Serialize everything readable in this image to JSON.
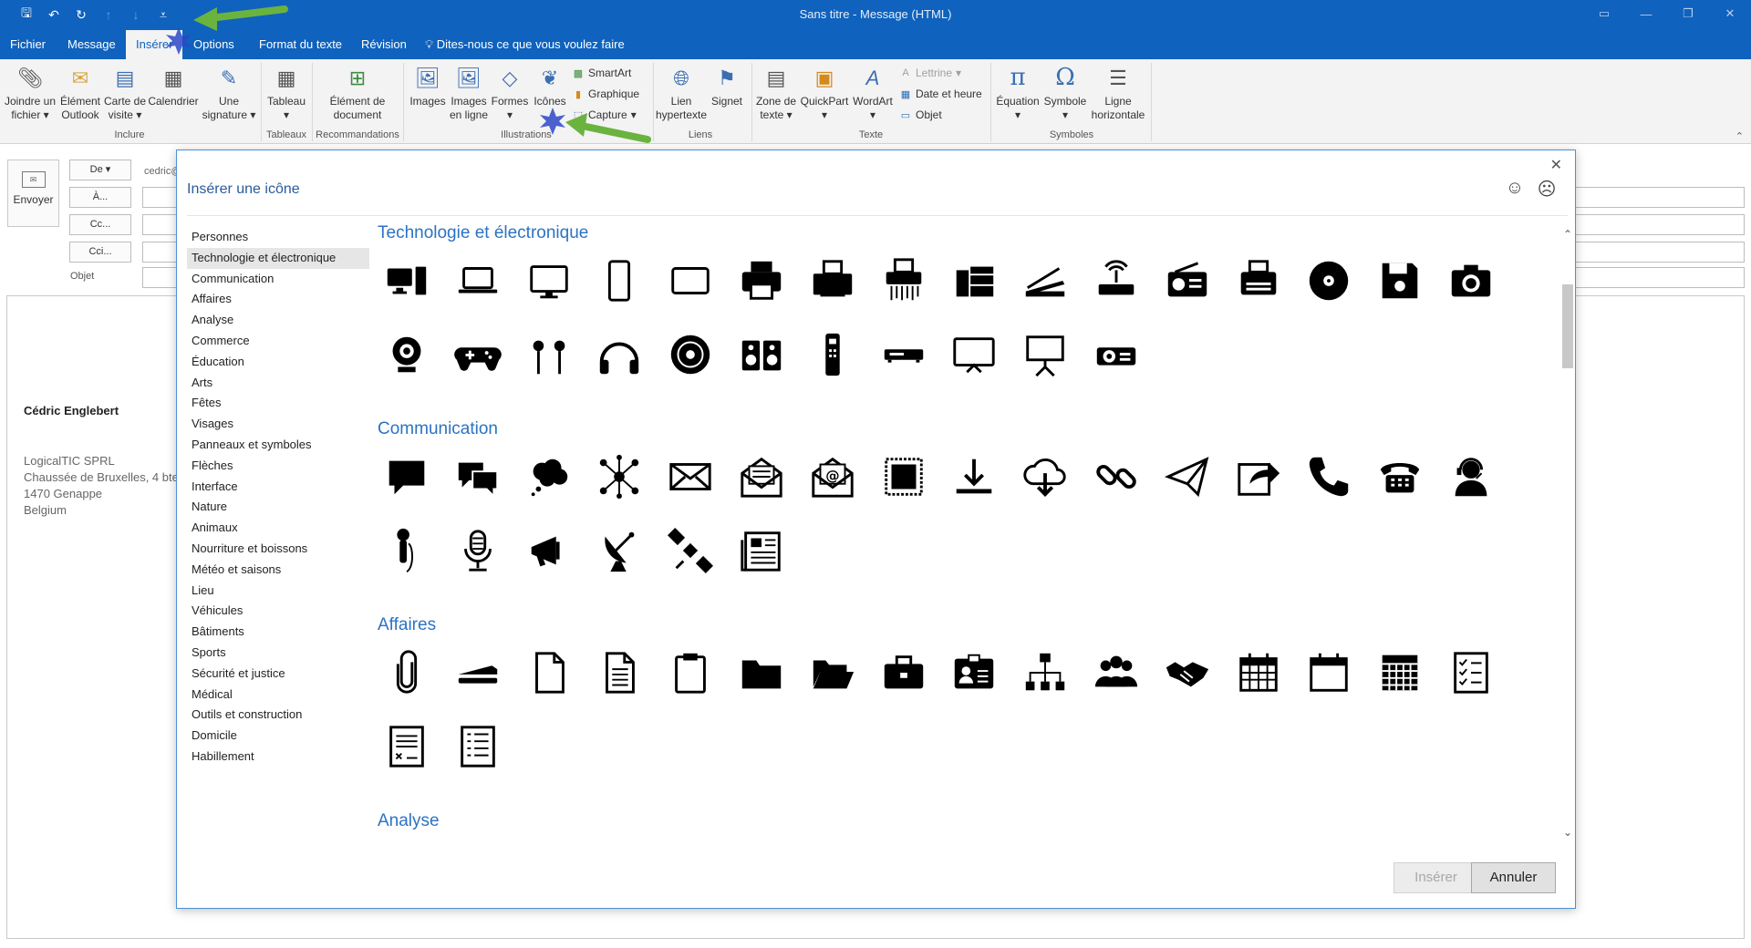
{
  "window": {
    "title": "Sans titre  -  Message (HTML)"
  },
  "qat": {
    "items": [
      {
        "name": "save-icon",
        "glyph": "🖫"
      },
      {
        "name": "undo-icon",
        "glyph": "↶"
      },
      {
        "name": "redo-icon",
        "glyph": "↻"
      },
      {
        "name": "up-icon",
        "glyph": "↑"
      },
      {
        "name": "down-icon",
        "glyph": "↓"
      },
      {
        "name": "customize-qat-icon",
        "glyph": "⩡"
      }
    ]
  },
  "menu": {
    "tabs": [
      "Fichier",
      "Message",
      "Insérer",
      "Options",
      "Format du texte",
      "Révision"
    ],
    "active_tab": "Insérer",
    "tell_me": "Dites-nous ce que vous voulez faire"
  },
  "ribbon": {
    "groups": {
      "inclure": "Inclure",
      "tableaux": "Tableaux",
      "recommandations": "Recommandations",
      "illustrations": "Illustrations",
      "liens": "Liens",
      "texte": "Texte",
      "symboles": "Symboles"
    },
    "buttons": {
      "joindre_line1": "Joindre un",
      "joindre_line2": "fichier",
      "element_line1": "Élément",
      "element_line2": "Outlook",
      "carte_line1": "Carte de",
      "carte_line2": "visite",
      "calendrier": "Calendrier",
      "signature_line1": "Une",
      "signature_line2": "signature",
      "tableau": "Tableau",
      "elemdoc_line1": "Élément de",
      "elemdoc_line2": "document",
      "images": "Images",
      "images_ligne_line1": "Images",
      "images_ligne_line2": "en ligne",
      "formes": "Formes",
      "icones": "Icônes",
      "smartart": "SmartArt",
      "graphique": "Graphique",
      "capture": "Capture",
      "lien_line1": "Lien",
      "lien_line2": "hypertexte",
      "signet": "Signet",
      "zone_line1": "Zone de",
      "zone_line2": "texte",
      "quickpart": "QuickPart",
      "wordart": "WordArt",
      "lettrine": "Lettrine",
      "date_heure": "Date et heure",
      "objet": "Objet",
      "equation": "Équation",
      "symbole": "Symbole",
      "ligne_line1": "Ligne",
      "ligne_line2": "horizontale"
    }
  },
  "compose": {
    "send": "Envoyer",
    "from_button": "De",
    "from_value": "cedric@",
    "to_button": "À...",
    "cc_button": "Cc...",
    "bcc_button": "Cci...",
    "subject_label": "Objet",
    "signature": {
      "name": "Cédric Englebert",
      "lines": [
        "LogicalTIC SPRL",
        "Chaussée de Bruxelles, 4 bte",
        "1470 Genappe",
        "Belgium"
      ]
    }
  },
  "dialog": {
    "title": "Insérer une icône",
    "close_glyph": "✕",
    "happy_glyph": "☺",
    "sad_glyph": "☹",
    "categories": [
      "Personnes",
      "Technologie et électronique",
      "Communication",
      "Affaires",
      "Analyse",
      "Commerce",
      "Éducation",
      "Arts",
      "Fêtes",
      "Visages",
      "Panneaux et symboles",
      "Flèches",
      "Interface",
      "Nature",
      "Animaux",
      "Nourriture et boissons",
      "Météo et saisons",
      "Lieu",
      "Véhicules",
      "Bâtiments",
      "Sports",
      "Sécurité et justice",
      "Médical",
      "Outils et construction",
      "Domicile",
      "Habillement"
    ],
    "selected_category": "Technologie et électronique",
    "sections": [
      {
        "title": "Technologie et électronique",
        "icons": [
          "desktop-computer-icon",
          "laptop-icon",
          "monitor-icon",
          "smartphone-icon",
          "tablet-icon",
          "printer-icon",
          "printer-2-icon",
          "shredder-icon",
          "server-rack-icon",
          "scanner-icon",
          "router-icon",
          "radio-icon",
          "typewriter-icon",
          "cd-disc-icon",
          "floppy-disk-icon",
          "camera-icon",
          "webcam-icon",
          "gamepad-icon",
          "earbuds-icon",
          "headphones-icon",
          "vinyl-record-icon",
          "speakers-icon",
          "remote-control-icon",
          "dvd-player-icon",
          "television-icon",
          "presentation-board-icon",
          "projector-icon"
        ]
      },
      {
        "title": "Communication",
        "icons": [
          "speech-bubble-icon",
          "chat-bubbles-icon",
          "thought-bubble-icon",
          "network-nodes-icon",
          "envelope-icon",
          "open-letter-icon",
          "email-at-icon",
          "postage-stamp-icon",
          "download-icon",
          "cloud-download-icon",
          "link-icon",
          "paper-plane-icon",
          "share-icon",
          "phone-handset-icon",
          "telephone-icon",
          "support-agent-icon",
          "microphone-handheld-icon",
          "studio-microphone-icon",
          "megaphone-icon",
          "satellite-dish-icon",
          "satellite-icon",
          "newspaper-icon"
        ]
      },
      {
        "title": "Affaires",
        "icons": [
          "paperclip-icon",
          "stapler-icon",
          "blank-document-icon",
          "text-document-icon",
          "clipboard-icon",
          "folder-icon",
          "open-folder-icon",
          "briefcase-icon",
          "id-badge-icon",
          "org-chart-icon",
          "team-icon",
          "handshake-icon",
          "calendar-icon",
          "calendar-blank-icon",
          "calendar-grid-icon",
          "checklist-icon",
          "invoice-icon",
          "list-document-icon"
        ]
      },
      {
        "title": "Analyse",
        "icons": []
      }
    ],
    "insert_button": "Insérer",
    "cancel_button": "Annuler"
  },
  "colors": {
    "brand_blue": "#0f62bd",
    "section_title": "#2b73c4",
    "annotation_green": "#6bb33f"
  }
}
